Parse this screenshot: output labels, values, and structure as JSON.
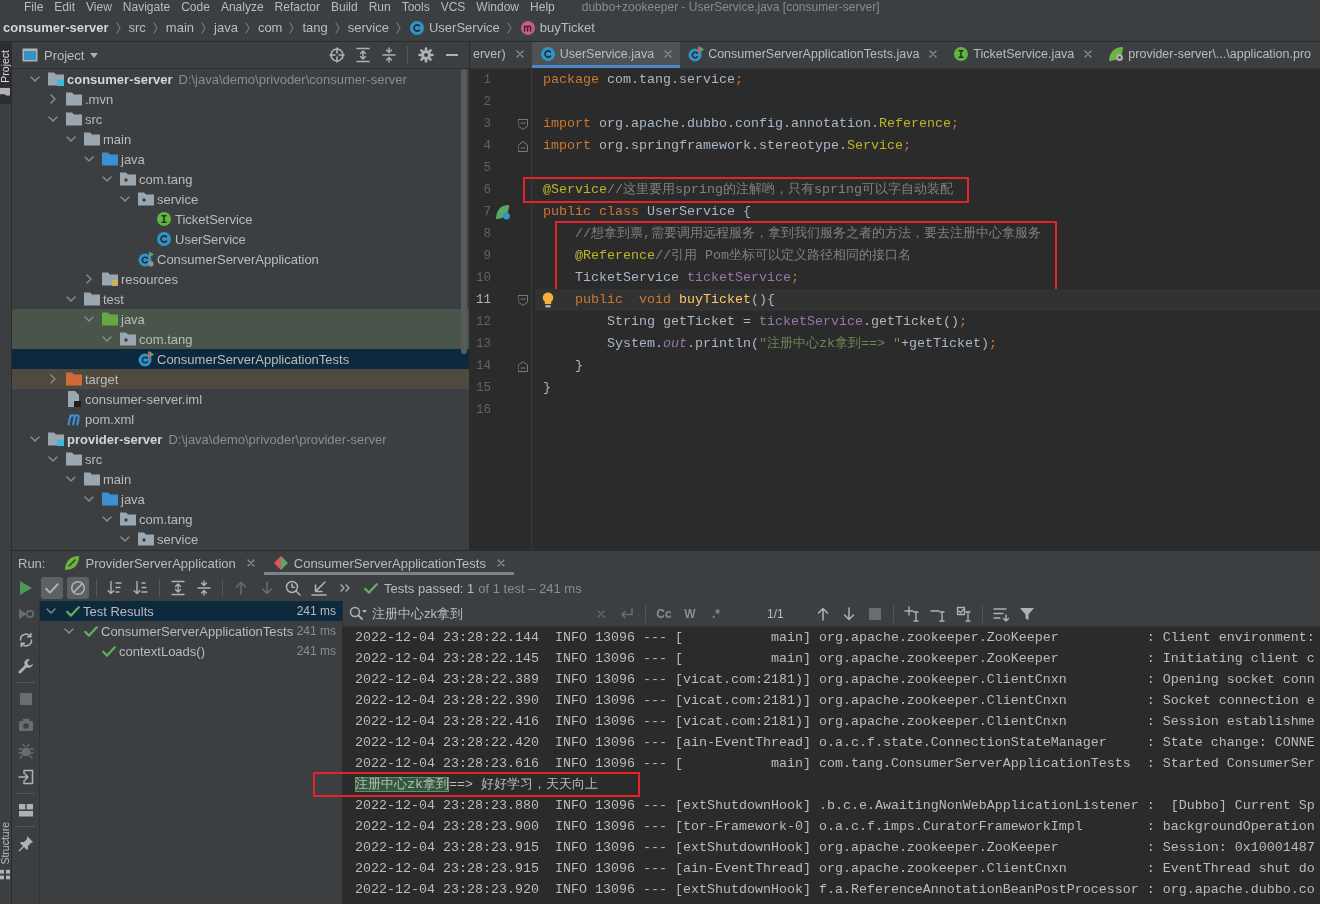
{
  "menu_bar": {
    "items": [
      "File",
      "Edit",
      "View",
      "Navigate",
      "Code",
      "Analyze",
      "Refactor",
      "Build",
      "Run",
      "Tools",
      "VCS",
      "Window",
      "Help"
    ],
    "title": "dubbo+zookeeper - UserService.java [consumer-server]"
  },
  "breadcrumbs": [
    {
      "label": "consumer-server",
      "kind": "module"
    },
    {
      "label": "src",
      "kind": "folder"
    },
    {
      "label": "main",
      "kind": "folder"
    },
    {
      "label": "java",
      "kind": "folder"
    },
    {
      "label": "com",
      "kind": "folder"
    },
    {
      "label": "tang",
      "kind": "folder"
    },
    {
      "label": "service",
      "kind": "folder"
    },
    {
      "label": "UserService",
      "kind": "class"
    },
    {
      "label": "buyTicket",
      "kind": "method"
    }
  ],
  "tool_stripe": {
    "top_tabs": [
      {
        "label": "Project",
        "selected": true
      }
    ],
    "bottom_tabs": [
      {
        "label": "Structure",
        "selected": false
      }
    ]
  },
  "project_panel": {
    "title": "Project",
    "tree": [
      {
        "label": "consumer-server",
        "kind": "module",
        "path": "D:\\java\\demo\\privoder\\consumer-server",
        "expanded": true,
        "selected": false,
        "children": [
          {
            "label": ".mvn",
            "kind": "folder",
            "expanded": false,
            "selected": false
          },
          {
            "label": "src",
            "kind": "folder",
            "expanded": true,
            "selected": false,
            "children": [
              {
                "label": "main",
                "kind": "folder",
                "expanded": true,
                "selected": false,
                "children": [
                  {
                    "label": "java",
                    "kind": "source-folder",
                    "expanded": true,
                    "selected": false,
                    "children": [
                      {
                        "label": "com.tang",
                        "kind": "package",
                        "expanded": true,
                        "selected": false,
                        "children": [
                          {
                            "label": "service",
                            "kind": "package",
                            "expanded": true,
                            "selected": false,
                            "children": [
                              {
                                "label": "TicketService",
                                "kind": "interface",
                                "selected": false
                              },
                              {
                                "label": "UserService",
                                "kind": "class",
                                "selected": false
                              }
                            ]
                          },
                          {
                            "label": "ConsumerServerApplication",
                            "kind": "spring-class",
                            "selected": false
                          }
                        ]
                      }
                    ]
                  },
                  {
                    "label": "resources",
                    "kind": "resources-folder",
                    "expanded": false,
                    "selected": false
                  }
                ]
              },
              {
                "label": "test",
                "kind": "folder",
                "expanded": true,
                "selected": false,
                "children": [
                  {
                    "label": "java",
                    "kind": "test-folder",
                    "expanded": true,
                    "selected": false,
                    "children": [
                      {
                        "label": "com.tang",
                        "kind": "test-package",
                        "expanded": true,
                        "selected": false,
                        "children": [
                          {
                            "label": "ConsumerServerApplicationTests",
                            "kind": "test-class",
                            "selected": true
                          }
                        ]
                      }
                    ]
                  }
                ]
              }
            ]
          },
          {
            "label": "target",
            "kind": "excluded-folder",
            "expanded": false,
            "selected": false
          },
          {
            "label": "consumer-server.iml",
            "kind": "iml-file",
            "selected": false
          },
          {
            "label": "pom.xml",
            "kind": "maven-file",
            "selected": false
          }
        ]
      },
      {
        "label": "provider-server",
        "kind": "module",
        "path": "D:\\java\\demo\\privoder\\provider-server",
        "expanded": true,
        "selected": false,
        "children": [
          {
            "label": "src",
            "kind": "folder",
            "expanded": true,
            "selected": false,
            "children": [
              {
                "label": "main",
                "kind": "folder",
                "expanded": true,
                "selected": false,
                "children": [
                  {
                    "label": "java",
                    "kind": "source-folder",
                    "expanded": true,
                    "selected": false,
                    "children": [
                      {
                        "label": "com.tang",
                        "kind": "package",
                        "expanded": true,
                        "selected": false,
                        "children": [
                          {
                            "label": "service",
                            "kind": "package",
                            "expanded": true,
                            "selected": false
                          }
                        ]
                      }
                    ]
                  }
                ]
              }
            ]
          }
        ]
      }
    ]
  },
  "editor": {
    "tabs": [
      {
        "label": "erver)",
        "kind": "clipped",
        "selected": false,
        "closable": true
      },
      {
        "label": "UserService.java",
        "kind": "class",
        "selected": true,
        "closable": true
      },
      {
        "label": "ConsumerServerApplicationTests.java",
        "kind": "test-class",
        "selected": false,
        "closable": true
      },
      {
        "label": "TicketService.java",
        "kind": "interface",
        "selected": false,
        "closable": true
      },
      {
        "label": "provider-server\\...\\application.pro",
        "kind": "spring-config",
        "selected": false,
        "closable": false
      }
    ],
    "blocks": [
      {
        "boxed": false,
        "lines": [
          {
            "number": "1",
            "kind": "plain",
            "current": false,
            "tokens": [
              {
                "kind": "keyword",
                "text": "package "
              },
              {
                "kind": "plain",
                "text": "com.tang.service"
              },
              {
                "kind": "keyword",
                "text": ";"
              }
            ]
          },
          {
            "number": "2",
            "kind": "plain",
            "current": false
          },
          {
            "number": "3",
            "kind": "fold-start",
            "current": false,
            "tokens": [
              {
                "kind": "keyword",
                "text": "import "
              },
              {
                "kind": "plain",
                "text": "org.apache.dubbo.config.annotation."
              },
              {
                "kind": "annotation",
                "text": "Reference"
              },
              {
                "kind": "keyword",
                "text": ";"
              }
            ]
          },
          {
            "number": "4",
            "kind": "fold-end",
            "current": false,
            "tokens": [
              {
                "kind": "keyword",
                "text": "import "
              },
              {
                "kind": "plain",
                "text": "org.springframework.stereotype."
              },
              {
                "kind": "annotation",
                "text": "Service"
              },
              {
                "kind": "keyword",
                "text": ";"
              }
            ]
          },
          {
            "number": "5",
            "kind": "plain",
            "current": false
          }
        ]
      },
      {
        "boxed": true,
        "lines": [
          {
            "number": "6",
            "kind": "plain",
            "current": false,
            "tokens": [
              {
                "kind": "annotation",
                "text": "@Service"
              },
              {
                "kind": "comment",
                "text": "//这里要用spring的注解哟，只有spring可以字自动装配"
              }
            ]
          }
        ]
      },
      {
        "boxed": false,
        "lines": [
          {
            "number": "7",
            "kind": "bean",
            "current": false,
            "tokens": [
              {
                "kind": "keyword",
                "text": "public class "
              },
              {
                "kind": "plain",
                "text": "UserService {"
              }
            ]
          }
        ]
      },
      {
        "boxed": true,
        "lines": [
          {
            "number": "8",
            "kind": "plain",
            "current": false,
            "tokens": [
              {
                "kind": "comment",
                "text": "    //想拿到票,需要调用远程服务，拿到我们服务之者的方法，要去注册中心拿服务"
              }
            ]
          },
          {
            "number": "9",
            "kind": "plain",
            "current": false,
            "tokens": [
              {
                "kind": "annotation",
                "text": "    @Reference"
              },
              {
                "kind": "comment",
                "text": "//引用 Pom坐标可以定义路径相同的接口名"
              }
            ]
          },
          {
            "number": "10",
            "kind": "plain",
            "current": false,
            "tokens": [
              {
                "kind": "plain",
                "text": "    TicketService "
              },
              {
                "kind": "field",
                "text": "ticketService"
              },
              {
                "kind": "keyword",
                "text": ";"
              }
            ]
          }
        ]
      },
      {
        "boxed": false,
        "lines": [
          {
            "number": "11",
            "kind": "fold-start",
            "current": true,
            "tokens": [
              {
                "kind": "keyword",
                "text": "    public  void "
              },
              {
                "kind": "method_decl",
                "text": "buyTicket"
              },
              {
                "kind": "plain",
                "text": "(){"
              }
            ]
          },
          {
            "number": "12",
            "kind": "plain",
            "current": false,
            "tokens": [
              {
                "kind": "plain",
                "text": "        String getTicket = "
              },
              {
                "kind": "field",
                "text": "ticketService"
              },
              {
                "kind": "plain",
                "text": ".getTicket()"
              },
              {
                "kind": "keyword",
                "text": ";"
              }
            ]
          },
          {
            "number": "13",
            "kind": "plain",
            "current": false,
            "tokens": [
              {
                "kind": "plain",
                "text": "        System."
              },
              {
                "kind": "static_field",
                "text": "out"
              },
              {
                "kind": "plain",
                "text": ".println("
              },
              {
                "kind": "string",
                "text": "\"注册中心zk拿到==> \""
              },
              {
                "kind": "plain",
                "text": "+getTicket)"
              },
              {
                "kind": "keyword",
                "text": ";"
              }
            ]
          },
          {
            "number": "14",
            "kind": "fold-end",
            "current": false,
            "tokens": [
              {
                "kind": "plain",
                "text": "    }"
              }
            ]
          },
          {
            "number": "15",
            "kind": "plain",
            "current": false,
            "tokens": [
              {
                "kind": "plain",
                "text": "}"
              }
            ]
          },
          {
            "number": "16",
            "kind": "plain",
            "current": false
          }
        ]
      }
    ]
  },
  "run_panel": {
    "label": "Run:",
    "tabs": [
      {
        "label": "ProviderServerApplication",
        "kind": "spring-boot",
        "selected": false
      },
      {
        "label": "ConsumerServerApplicationTests",
        "kind": "test-run",
        "selected": true
      }
    ],
    "toolbar": [
      [
        {
          "kind": "run",
          "pressed": false,
          "disabled": false
        },
        {
          "kind": "show-passed",
          "pressed": true,
          "disabled": false
        },
        {
          "kind": "show-ignored",
          "pressed": true,
          "disabled": false
        }
      ],
      [
        {
          "kind": "sort-alphabetically",
          "pressed": false,
          "disabled": false
        },
        {
          "kind": "sort-by-duration",
          "pressed": false,
          "disabled": false
        }
      ],
      [
        {
          "kind": "expand-all",
          "pressed": false,
          "disabled": false
        },
        {
          "kind": "collapse-all",
          "pressed": false,
          "disabled": false
        }
      ],
      [
        {
          "kind": "previous-failed",
          "pressed": false,
          "disabled": true
        },
        {
          "kind": "next-failed",
          "pressed": false,
          "disabled": true
        },
        {
          "kind": "test-history",
          "pressed": false,
          "disabled": false
        },
        {
          "kind": "import-tests",
          "pressed": false,
          "disabled": false
        },
        {
          "kind": "more",
          "pressed": false,
          "disabled": false
        }
      ]
    ],
    "passed": true,
    "summary": "Tests passed: 1",
    "summary_detail": "of 1 test – 241 ms",
    "side_toolbar": [
      [
        {
          "kind": "rerun-failed",
          "disabled": true
        },
        {
          "kind": "toggle-auto-test",
          "disabled": false
        },
        {
          "kind": "settings",
          "disabled": false
        }
      ],
      [
        {
          "kind": "stop",
          "disabled": true
        },
        {
          "kind": "screenshot",
          "disabled": true
        },
        {
          "kind": "debug",
          "disabled": true
        },
        {
          "kind": "exit",
          "disabled": false
        }
      ],
      [
        {
          "kind": "layout",
          "disabled": false
        }
      ],
      [
        {
          "kind": "pin",
          "disabled": false
        }
      ]
    ],
    "test_tree": [
      {
        "label": "Test Results",
        "time": "241 ms",
        "passed": true,
        "selected": true,
        "expanded": true,
        "children": [
          {
            "label": "ConsumerServerApplicationTests",
            "time": "241 ms",
            "passed": true,
            "selected": false,
            "expanded": true,
            "children": [
              {
                "label": "contextLoads()",
                "time": "241 ms",
                "passed": true,
                "selected": false
              }
            ]
          }
        ]
      }
    ]
  },
  "console": {
    "search": {
      "value": "注册中心zk拿到",
      "tools": [
        {
          "kind": "clear",
          "disabled": true
        },
        {
          "kind": "newline",
          "disabled": true
        }
      ]
    },
    "options": [
      {
        "label": "Cc",
        "selected": false
      },
      {
        "label": "W",
        "selected": false
      },
      {
        "label": ".*",
        "selected": false
      }
    ],
    "match_count": "1/1",
    "navigation": [
      [
        {
          "kind": "previous-match",
          "disabled": false
        },
        {
          "kind": "next-match",
          "disabled": false
        },
        {
          "kind": "select-all-matches",
          "disabled": true
        }
      ],
      [
        {
          "kind": "add-occurrence",
          "disabled": false
        },
        {
          "kind": "remove-occurrence",
          "disabled": false
        },
        {
          "kind": "select-occurrences",
          "disabled": false
        }
      ],
      [
        {
          "kind": "filter-lines",
          "disabled": false
        },
        {
          "kind": "filter",
          "disabled": false
        }
      ]
    ],
    "blocks": [
      {
        "boxed": false,
        "lines": [
          {
            "parts": [
              {
                "text": "2022-12-04 23:28:22.144  INFO 13096 --- [           main] org.apache.zookeeper.ZooKeeper           : Client environment:",
                "match": false
              }
            ]
          },
          {
            "parts": [
              {
                "text": "2022-12-04 23:28:22.145  INFO 13096 --- [           main] org.apache.zookeeper.ZooKeeper           : Initiating client c",
                "match": false
              }
            ]
          },
          {
            "parts": [
              {
                "text": "2022-12-04 23:28:22.389  INFO 13096 --- [vicat.com:2181)] org.apache.zookeeper.ClientCnxn          : Opening socket conn",
                "match": false
              }
            ]
          },
          {
            "parts": [
              {
                "text": "2022-12-04 23:28:22.390  INFO 13096 --- [vicat.com:2181)] org.apache.zookeeper.ClientCnxn          : Socket connection e",
                "match": false
              }
            ]
          },
          {
            "parts": [
              {
                "text": "2022-12-04 23:28:22.416  INFO 13096 --- [vicat.com:2181)] org.apache.zookeeper.ClientCnxn          : Session establishme",
                "match": false
              }
            ]
          },
          {
            "parts": [
              {
                "text": "2022-12-04 23:28:22.420  INFO 13096 --- [ain-EventThread] o.a.c.f.state.ConnectionStateManager     : State change: CONNE",
                "match": false
              }
            ]
          },
          {
            "parts": [
              {
                "text": "2022-12-04 23:28:23.616  INFO 13096 --- [           main] com.tang.ConsumerServerApplicationTests  : Started ConsumerSer",
                "match": false
              }
            ]
          }
        ]
      },
      {
        "boxed": true,
        "lines": [
          {
            "parts": [
              {
                "text": "注册中心zk拿到",
                "match": true
              },
              {
                "text": "==> 好好学习，天天向上",
                "match": false
              }
            ]
          }
        ]
      },
      {
        "boxed": false,
        "lines": [
          {
            "parts": [
              {
                "text": "2022-12-04 23:28:23.880  INFO 13096 --- [extShutdownHook] .b.c.e.AwaitingNonWebApplicationListener :  [Dubbo] Current Sp",
                "match": false
              }
            ]
          },
          {
            "parts": [
              {
                "text": "2022-12-04 23:28:23.900  INFO 13096 --- [tor-Framework-0] o.a.c.f.imps.CuratorFrameworkImpl        : backgroundOperation",
                "match": false
              }
            ]
          },
          {
            "parts": [
              {
                "text": "2022-12-04 23:28:23.915  INFO 13096 --- [extShutdownHook] org.apache.zookeeper.ZooKeeper           : Session: 0x10001487",
                "match": false
              }
            ]
          },
          {
            "parts": [
              {
                "text": "2022-12-04 23:28:23.915  INFO 13096 --- [ain-EventThread] org.apache.zookeeper.ClientCnxn          : EventThread shut do",
                "match": false
              }
            ]
          },
          {
            "parts": [
              {
                "text": "2022-12-04 23:28:23.920  INFO 13096 --- [extShutdownHook] f.a.ReferenceAnnotationBeanPostProcessor : org.apache.dubbo.co",
                "match": false
              }
            ]
          }
        ]
      }
    ]
  }
}
